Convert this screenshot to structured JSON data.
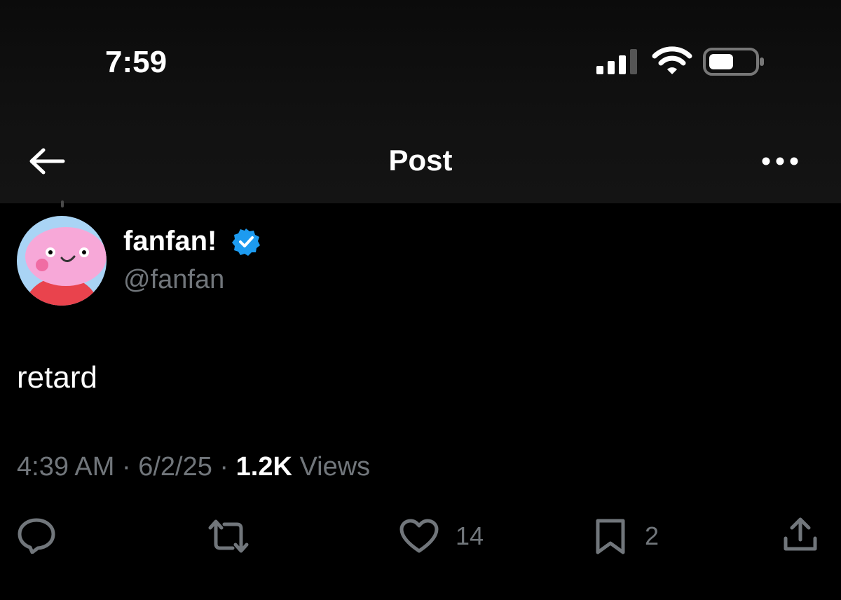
{
  "status_bar": {
    "time": "7:59",
    "icons": [
      "cellular-signal-icon",
      "wifi-icon",
      "battery-icon"
    ]
  },
  "nav": {
    "title": "Post",
    "back_icon": "arrow-left-icon",
    "more_icon": "more-horizontal-icon"
  },
  "post": {
    "author": {
      "display_name": "fanfan!",
      "handle": "@fanfan",
      "verified": true,
      "avatar_colors": {
        "background": "#a9d4f5",
        "face": "#f7a8d8",
        "shirt": "#e9434d"
      }
    },
    "text": "retard",
    "meta": {
      "time": "4:39 AM",
      "separator": "·",
      "date": "6/2/25",
      "views_count": "1.2K",
      "views_label": "Views"
    },
    "actions": {
      "reply": {
        "icon": "reply-icon"
      },
      "repost": {
        "icon": "repost-icon"
      },
      "like": {
        "icon": "heart-icon",
        "count": "14"
      },
      "bookmark": {
        "icon": "bookmark-icon",
        "count": "2"
      },
      "share": {
        "icon": "share-icon"
      }
    }
  },
  "colors": {
    "background": "#000000",
    "text_primary": "#ffffff",
    "text_secondary": "#71767b",
    "verified_blue": "#1d9bf0"
  }
}
